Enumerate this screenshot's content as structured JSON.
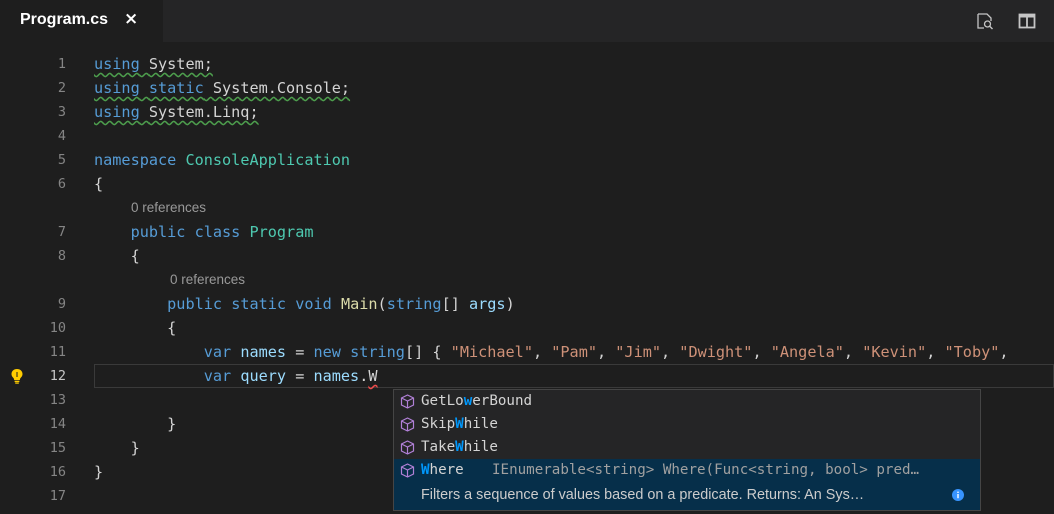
{
  "tab": {
    "title": "Program.cs",
    "close": "×"
  },
  "toolbar": {
    "icons": [
      "open-changes-icon",
      "split-editor-icon"
    ]
  },
  "lines": [
    {
      "n": "1",
      "tokens": [
        [
          "kw",
          "using"
        ],
        [
          "",
          " "
        ],
        [
          "",
          "System;"
        ]
      ]
    },
    {
      "n": "2",
      "tokens": [
        [
          "kw",
          "using"
        ],
        [
          "",
          " "
        ],
        [
          "kw",
          "static"
        ],
        [
          "",
          " System.Console;"
        ]
      ]
    },
    {
      "n": "3",
      "tokens": [
        [
          "kw",
          "using"
        ],
        [
          "",
          " "
        ],
        [
          "",
          "System.Linq;"
        ]
      ]
    },
    {
      "n": "4",
      "tokens": []
    },
    {
      "n": "5",
      "tokens": [
        [
          "kw",
          "namespace"
        ],
        [
          "",
          " "
        ],
        [
          "ty",
          "ConsoleApplication"
        ]
      ]
    },
    {
      "n": "6",
      "tokens": [
        [
          "",
          "{"
        ]
      ]
    },
    {
      "n": "7",
      "tokens": [
        [
          "",
          "    "
        ],
        [
          "kw",
          "public"
        ],
        [
          "",
          " "
        ],
        [
          "kw",
          "class"
        ],
        [
          "",
          " "
        ],
        [
          "ty",
          "Program"
        ]
      ]
    },
    {
      "n": "8",
      "tokens": [
        [
          "",
          "    {"
        ]
      ]
    },
    {
      "n": "9",
      "tokens": [
        [
          "",
          "        "
        ],
        [
          "kw",
          "public"
        ],
        [
          "",
          " "
        ],
        [
          "kw",
          "static"
        ],
        [
          "",
          " "
        ],
        [
          "kw",
          "void"
        ],
        [
          "",
          " "
        ],
        [
          "fn",
          "Main"
        ],
        [
          "",
          "("
        ],
        [
          "kw",
          "string"
        ],
        [
          "",
          "[] "
        ],
        [
          "pm",
          "args"
        ],
        [
          "",
          ")"
        ]
      ]
    },
    {
      "n": "10",
      "tokens": [
        [
          "",
          "        {"
        ]
      ]
    },
    {
      "n": "11",
      "tokens": [
        [
          "",
          "            "
        ],
        [
          "kw",
          "var"
        ],
        [
          "",
          " "
        ],
        [
          "pm",
          "names"
        ],
        [
          "",
          " = "
        ],
        [
          "kw",
          "new"
        ],
        [
          "",
          " "
        ],
        [
          "kw",
          "string"
        ],
        [
          "",
          "[] { "
        ],
        [
          "str",
          "\"Michael\""
        ],
        [
          "",
          ", "
        ],
        [
          "str",
          "\"Pam\""
        ],
        [
          "",
          ", "
        ],
        [
          "str",
          "\"Jim\""
        ],
        [
          "",
          ", "
        ],
        [
          "str",
          "\"Dwight\""
        ],
        [
          "",
          ", "
        ],
        [
          "str",
          "\"Angela\""
        ],
        [
          "",
          ", "
        ],
        [
          "str",
          "\"Kevin\""
        ],
        [
          "",
          ", "
        ],
        [
          "str",
          "\"Toby\""
        ],
        [
          "",
          ","
        ]
      ]
    },
    {
      "n": "12",
      "tokens": [
        [
          "",
          "            "
        ],
        [
          "kw",
          "var"
        ],
        [
          "",
          " "
        ],
        [
          "pm",
          "query"
        ],
        [
          "",
          " = "
        ],
        [
          "pm",
          "names"
        ],
        [
          "",
          "."
        ],
        [
          "",
          "W"
        ]
      ]
    },
    {
      "n": "13",
      "tokens": []
    },
    {
      "n": "14",
      "tokens": [
        [
          "",
          "        }"
        ]
      ]
    },
    {
      "n": "15",
      "tokens": [
        [
          "",
          "    }"
        ]
      ]
    },
    {
      "n": "16",
      "tokens": [
        [
          "",
          "}"
        ]
      ]
    },
    {
      "n": "17",
      "tokens": []
    }
  ],
  "codelens": {
    "label": "0 references"
  },
  "suggest": {
    "items": [
      {
        "pre": "GetLo",
        "hl": "w",
        "post": "erBound"
      },
      {
        "pre": "Skip",
        "hl": "W",
        "post": "hile"
      },
      {
        "pre": "Take",
        "hl": "W",
        "post": "hile"
      },
      {
        "pre": "",
        "hl": "W",
        "post": "here"
      }
    ],
    "selected_detail": "IEnumerable<string> Where(Func<string, bool> pred…",
    "doc": "Filters a sequence of values based on a predicate. Returns: An Sys…"
  },
  "colors": {
    "keyword": "#569cd6",
    "type": "#4ec9b0",
    "string": "#ce9178",
    "highlight": "#0097fb",
    "method_icon": "#b180d7"
  }
}
